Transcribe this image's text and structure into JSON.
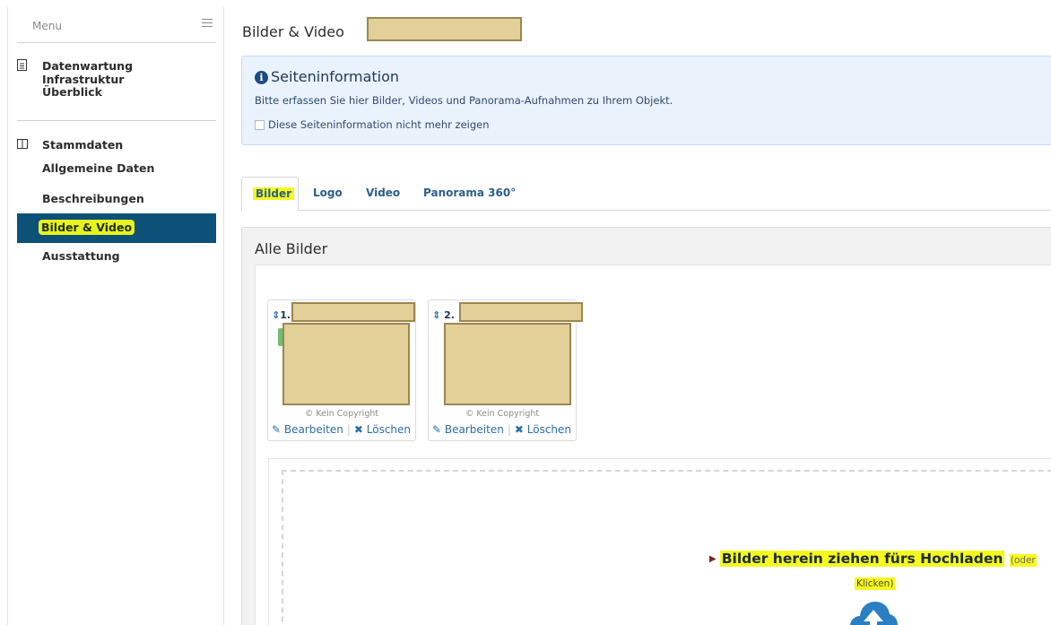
{
  "sidebar": {
    "menu_label": "Menu",
    "sections": [
      {
        "title": "Datenwartung Infrastruktur",
        "icon": "document-icon",
        "items": [
          "Überblick"
        ]
      },
      {
        "title": "Stammdaten",
        "icon": "columns-icon",
        "items": [
          "Allgemeine Daten",
          "Beschreibungen",
          "Bilder & Video",
          "Ausstattung"
        ],
        "active_index": 2
      }
    ]
  },
  "header": {
    "title": "Bilder & Video"
  },
  "info": {
    "title": "Seiteninformation",
    "text": "Bitte erfassen Sie hier Bilder, Videos und Panorama-Aufnahmen zu Ihrem Objekt.",
    "checkbox_label": "Diese Seiteninformation nicht mehr zeigen"
  },
  "tabs": [
    {
      "label": "Bilder",
      "active": true
    },
    {
      "label": "Logo",
      "active": false
    },
    {
      "label": "Video",
      "active": false
    },
    {
      "label": "Panorama 360°",
      "active": false
    }
  ],
  "panel": {
    "title": "Alle Bilder",
    "images": [
      {
        "number": "1.",
        "copyright": "© Kein Copyright",
        "edit_label": "Bearbeiten",
        "delete_label": "Löschen"
      },
      {
        "number": "2.",
        "copyright": "© Kein Copyright",
        "edit_label": "Bearbeiten",
        "delete_label": "Löschen"
      }
    ],
    "dropzone": {
      "title": "Bilder herein ziehen fürs Hochladen",
      "hint_a": "(oder",
      "hint_b": "Klicken)"
    }
  },
  "colors": {
    "active_nav": "#0d5078",
    "highlight": "#f5f91e",
    "redaction": "#e3cf98",
    "link": "#2c6ea5",
    "upload_icon": "#2a7ec2"
  }
}
